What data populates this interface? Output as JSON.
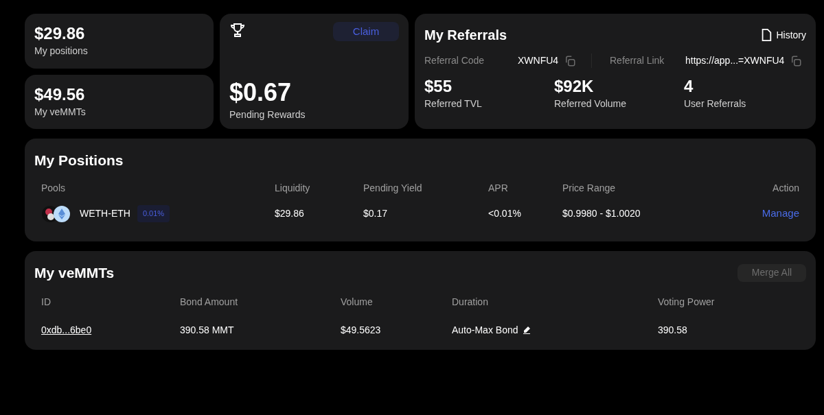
{
  "stats": [
    {
      "value": "$29.86",
      "label": "My positions"
    },
    {
      "value": "$49.56",
      "label": "My veMMTs"
    }
  ],
  "rewards": {
    "claim": {
      "label": "Claim",
      "disabled": false
    },
    "value": "$0.67",
    "label": "Pending Rewards"
  },
  "referrals": {
    "title": "My Referrals",
    "history": "History",
    "fields": [
      {
        "label": "Referral Code",
        "value": "XWNFU4"
      },
      {
        "label": "Referral Link",
        "value": "https://app...=XWNFU4"
      }
    ],
    "metrics": [
      {
        "value": "$55",
        "label": "Referred TVL"
      },
      {
        "value": "$92K",
        "label": "Referred Volume"
      },
      {
        "value": "4",
        "label": "User Referrals"
      }
    ]
  },
  "positions": {
    "title": "My Positions",
    "columns": [
      "Pools",
      "Liquidity",
      "Pending Yield",
      "APR",
      "Price Range",
      "Action"
    ],
    "rows": [
      {
        "pool": "WETH-ETH",
        "fee": "0.01%",
        "liquidity": "$29.86",
        "pending_yield": "$0.17",
        "apr": "<0.01%",
        "price_range": "$0.9980 - $1.0020",
        "action": "Manage"
      }
    ]
  },
  "vemmts": {
    "title": "My veMMTs",
    "merge": {
      "label": "Merge All",
      "disabled": true
    },
    "columns": [
      "ID",
      "Bond Amount",
      "Volume",
      "Duration",
      "Voting Power"
    ],
    "rows": [
      {
        "id": "0xdb...6be0",
        "bond_amount": "390.58 MMT",
        "volume": "$49.5623",
        "duration": "Auto-Max Bond",
        "voting_power": "390.58"
      }
    ]
  }
}
